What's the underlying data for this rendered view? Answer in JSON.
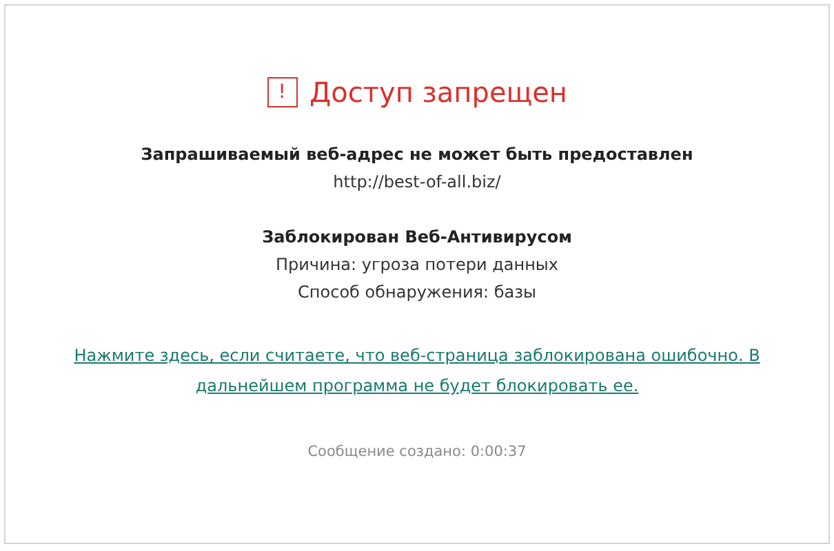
{
  "header": {
    "icon_text": "!",
    "title": "Доступ запрещен"
  },
  "details": [
    {
      "kind": "heading",
      "text": "Запрашиваемый веб-адрес не может быть предоставлен"
    },
    {
      "kind": "line",
      "text": "http://best-of-all.biz/"
    },
    {
      "kind": "spacer"
    },
    {
      "kind": "heading",
      "text": "Заблокирован Веб-Антивирусом"
    },
    {
      "kind": "line",
      "text": "Причина: угроза потери данных"
    },
    {
      "kind": "line",
      "text": "Способ обнаружения: базы"
    }
  ],
  "link": "Нажмите здесь, если считаете, что веб-страница заблокирована ошибочно. В дальнейшем программа не будет блокировать ее.",
  "footer": "Сообщение создано: 0:00:37"
}
